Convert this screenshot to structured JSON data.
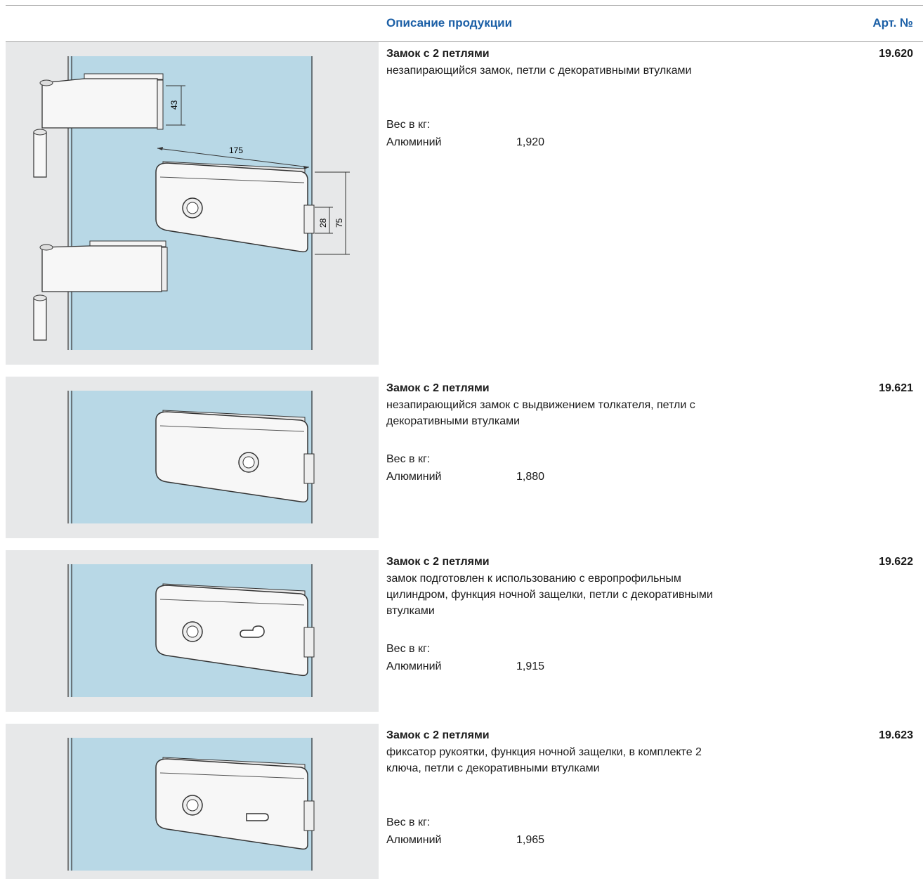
{
  "header": {
    "description_label": "Описание продукции",
    "article_label": "Арт. №"
  },
  "products": [
    {
      "title": "Замок с 2 петлями",
      "description": "незапирающийся замок, петли с декоративными втулками",
      "weight_label": "Вес в кг:",
      "material": "Алюминий",
      "weight": "1,920",
      "article": "19.620",
      "dimensions": {
        "hinge_height": "43",
        "lock_width": "175",
        "latch_height": "28",
        "lock_height": "75"
      }
    },
    {
      "title": "Замок с 2 петлями",
      "description": "незапирающийся замок с выдвижением толкателя, петли с декоративными втулками",
      "weight_label": "Вес в кг:",
      "material": "Алюминий",
      "weight": "1,880",
      "article": "19.621"
    },
    {
      "title": "Замок с 2 петлями",
      "description": "замок подготовлен к использованию с европрофильным цилиндром, функция ночной защелки, петли с декоративными втулками",
      "weight_label": "Вес в кг:",
      "material": "Алюминий",
      "weight": "1,915",
      "article": "19.622"
    },
    {
      "title": "Замок с 2 петлями",
      "description": "фиксатор рукоятки, функция ночной защелки, в комплекте 2 ключа, петли с декоративными втулками",
      "weight_label": "Вес в кг:",
      "material": "Алюминий",
      "weight": "1,965",
      "article": "19.623"
    }
  ],
  "colors": {
    "accent": "#1b5fa6",
    "glass": "#b8d8e6",
    "panel": "#e7e8e9"
  }
}
